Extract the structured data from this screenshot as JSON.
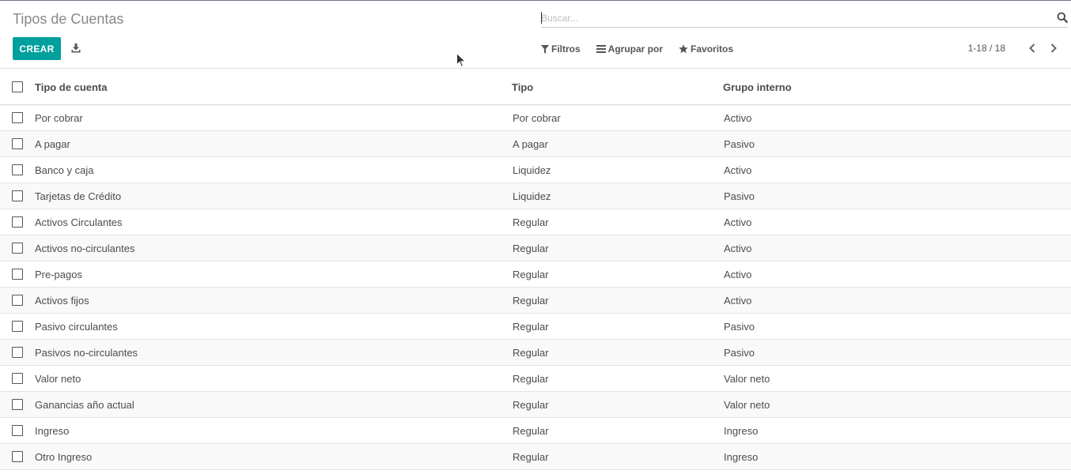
{
  "page": {
    "title": "Tipos de Cuentas"
  },
  "toolbar": {
    "create_label": "CREAR",
    "download_icon": "download-icon"
  },
  "search": {
    "placeholder": "Buscar...",
    "value": ""
  },
  "filters": {
    "filters_label": "Filtros",
    "groupby_label": "Agrupar por",
    "favorites_label": "Favoritos"
  },
  "pager": {
    "value": "1-18 / 18"
  },
  "table": {
    "headers": {
      "name": "Tipo de cuenta",
      "type": "Tipo",
      "group": "Grupo interno"
    },
    "rows": [
      {
        "name": "Por cobrar",
        "type": "Por cobrar",
        "group": "Activo"
      },
      {
        "name": "A pagar",
        "type": "A pagar",
        "group": "Pasivo"
      },
      {
        "name": "Banco y caja",
        "type": "Liquidez",
        "group": "Activo"
      },
      {
        "name": "Tarjetas de Crédito",
        "type": "Liquidez",
        "group": "Pasivo"
      },
      {
        "name": "Activos Circulantes",
        "type": "Regular",
        "group": "Activo"
      },
      {
        "name": "Activos no-circulantes",
        "type": "Regular",
        "group": "Activo"
      },
      {
        "name": "Pre-pagos",
        "type": "Regular",
        "group": "Activo"
      },
      {
        "name": "Activos fijos",
        "type": "Regular",
        "group": "Activo"
      },
      {
        "name": "Pasivo circulantes",
        "type": "Regular",
        "group": "Pasivo"
      },
      {
        "name": "Pasivos no-circulantes",
        "type": "Regular",
        "group": "Pasivo"
      },
      {
        "name": "Valor neto",
        "type": "Regular",
        "group": "Valor neto"
      },
      {
        "name": "Ganancias año actual",
        "type": "Regular",
        "group": "Valor neto"
      },
      {
        "name": "Ingreso",
        "type": "Regular",
        "group": "Ingreso"
      },
      {
        "name": "Otro Ingreso",
        "type": "Regular",
        "group": "Ingreso"
      }
    ]
  },
  "colors": {
    "accent": "#00a09d",
    "topline": "#7c6a85",
    "text": "#4c4c4c",
    "title": "#888888"
  }
}
